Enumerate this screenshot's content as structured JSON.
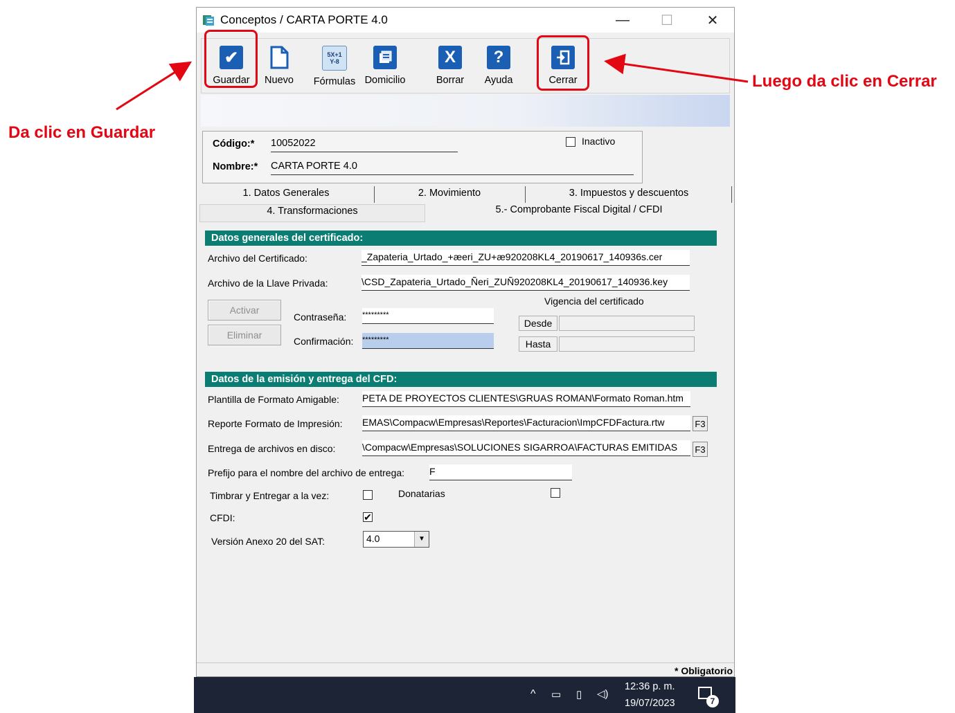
{
  "window": {
    "title": "Conceptos / CARTA PORTE 4.0",
    "controls": {
      "minimize": "—",
      "maximize": "☐",
      "close": "✕"
    }
  },
  "toolbar": {
    "buttons": [
      {
        "label": "Guardar",
        "icon": "check-icon"
      },
      {
        "label": "Nuevo",
        "icon": "new-document-icon"
      },
      {
        "label": "Fórmulas",
        "icon": "formulas-icon"
      },
      {
        "label": "Domicilio",
        "icon": "address-icon"
      },
      {
        "label": "Borrar",
        "icon": "delete-icon"
      },
      {
        "label": "Ayuda",
        "icon": "help-icon"
      },
      {
        "label": "Cerrar",
        "icon": "exit-icon"
      }
    ],
    "formula_icon_text": "5X+1\nY-8"
  },
  "header": {
    "codigo_label": "Código:*",
    "codigo_value": "10052022",
    "nombre_label": "Nombre:*",
    "nombre_value": "CARTA PORTE 4.0",
    "inactivo_label": "Inactivo"
  },
  "tabs": [
    "1. Datos Generales",
    "2. Movimiento",
    "3. Impuestos y descuentos",
    "4. Transformaciones",
    "5.- Comprobante Fiscal Digital / CFDI"
  ],
  "certificado": {
    "section_title": "Datos generales del certificado:",
    "archivo_cert_label": "Archivo del Certificado:",
    "archivo_cert_value": "_Zapateria_Urtado_+æeri_ZU+æ920208KL4_20190617_140936s.cer",
    "llave_label": "Archivo de la Llave Privada:",
    "llave_value": "\\CSD_Zapateria_Urtado_Ñeri_ZUÑ920208KL4_20190617_140936.key",
    "activar_label": "Activar",
    "eliminar_label": "Eliminar",
    "contrasena_label": "Contraseña:",
    "contrasena_value": "*********",
    "confirmacion_label": "Confirmación:",
    "confirmacion_value": "*********",
    "vigencia_label": "Vigencia del certificado",
    "desde_label": "Desde",
    "hasta_label": "Hasta"
  },
  "emision": {
    "section_title": "Datos de la emisión y entrega del CFD:",
    "plantilla_label": "Plantilla de Formato Amigable:",
    "plantilla_value": "PETA DE PROYECTOS CLIENTES\\GRUAS ROMAN\\Formato Roman.htm",
    "reporte_label": "Reporte Formato de Impresión:",
    "reporte_value": "EMAS\\Compacw\\Empresas\\Reportes\\Facturacion\\ImpCFDFactura.rtw",
    "entrega_label": "Entrega de archivos en disco:",
    "entrega_value": "\\Compacw\\Empresas\\SOLUCIONES SIGARROA\\FACTURAS EMITIDAS",
    "f3_label": "F3",
    "prefijo_label": "Prefijo para el nombre del archivo de entrega:",
    "prefijo_value": "F",
    "timbrar_label": "Timbrar y Entregar a la vez:",
    "timbrar_checked": false,
    "donatarias_label": "Donatarias",
    "donatarias_checked": false,
    "cfdi_label": "CFDI:",
    "cfdi_checked": true,
    "version_label": "Versión Anexo 20 del SAT:",
    "version_value": "4.0"
  },
  "footer": {
    "obligatorio": "* Obligatorio"
  },
  "taskbar": {
    "time": "12:36 p. m.",
    "date": "19/07/2023",
    "notification_count": "7"
  },
  "annotations": {
    "guardar_text": "Da clic en Guardar",
    "cerrar_text": "Luego da clic en Cerrar",
    "color": "#e30613"
  },
  "colors": {
    "section_header": "#0c7d72",
    "taskbar": "#1c2436"
  }
}
